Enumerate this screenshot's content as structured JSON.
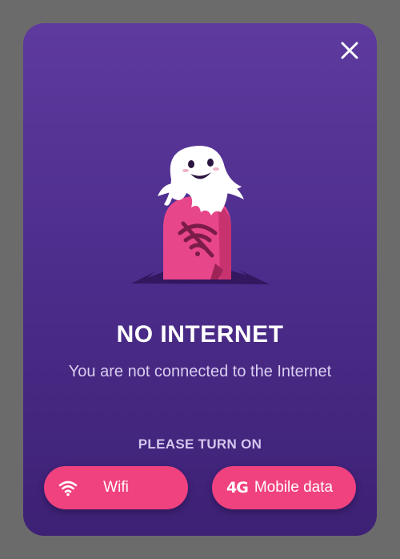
{
  "dialog": {
    "title": "NO INTERNET",
    "message": "You are not connected to the Internet",
    "prompt": "PLEASE TURN ON",
    "close_icon": "close-icon",
    "illustration": "ghost-tombstone-no-wifi"
  },
  "buttons": {
    "wifi": {
      "label": "Wifi",
      "icon": "wifi-icon"
    },
    "mobile": {
      "label": "Mobile data",
      "icon_text": "4G"
    }
  },
  "colors": {
    "background": "#6b6b6b",
    "card_top": "#5e3a9e",
    "card_bottom": "#3d2175",
    "accent": "#f0427e",
    "tombstone": "#e8468a",
    "text_primary": "#ffffff",
    "text_secondary": "#d9cdef"
  }
}
